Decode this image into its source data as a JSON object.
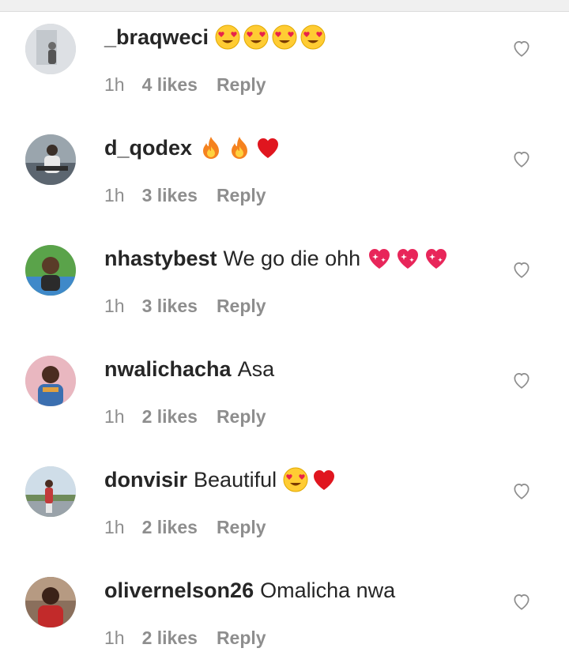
{
  "comments": [
    {
      "username": "_braqweci",
      "text": "",
      "emojis": [
        "heart-eyes-emoji",
        "heart-eyes-emoji",
        "heart-eyes-emoji",
        "heart-eyes-emoji"
      ],
      "time": "1h",
      "likes": "4 likes",
      "reply": "Reply",
      "avatar_color": "#d9dde2"
    },
    {
      "username": "d_qodex",
      "text": "",
      "emojis": [
        "fire-emoji",
        "fire-emoji",
        "red-heart-emoji"
      ],
      "time": "1h",
      "likes": "3 likes",
      "reply": "Reply",
      "avatar_color": "#6e7a85"
    },
    {
      "username": "nhastybest",
      "text": "We go die ohh",
      "emojis": [
        "sparkling-heart-emoji",
        "sparkling-heart-emoji",
        "sparkling-heart-emoji"
      ],
      "time": "1h",
      "likes": "3 likes",
      "reply": "Reply",
      "avatar_color": "#4a8a3e"
    },
    {
      "username": "nwalichacha",
      "text": "Asa",
      "emojis": [],
      "time": "1h",
      "likes": "2 likes",
      "reply": "Reply",
      "avatar_color": "#b56a7a"
    },
    {
      "username": "donvisir",
      "text": "Beautiful",
      "emojis": [
        "heart-eyes-emoji",
        "red-heart-emoji"
      ],
      "time": "1h",
      "likes": "2 likes",
      "reply": "Reply",
      "avatar_color": "#8fa7b8"
    },
    {
      "username": "olivernelson26",
      "text": "Omalicha nwa",
      "emojis": [],
      "time": "1h",
      "likes": "2 likes",
      "reply": "Reply",
      "avatar_color": "#7a3b30"
    }
  ]
}
